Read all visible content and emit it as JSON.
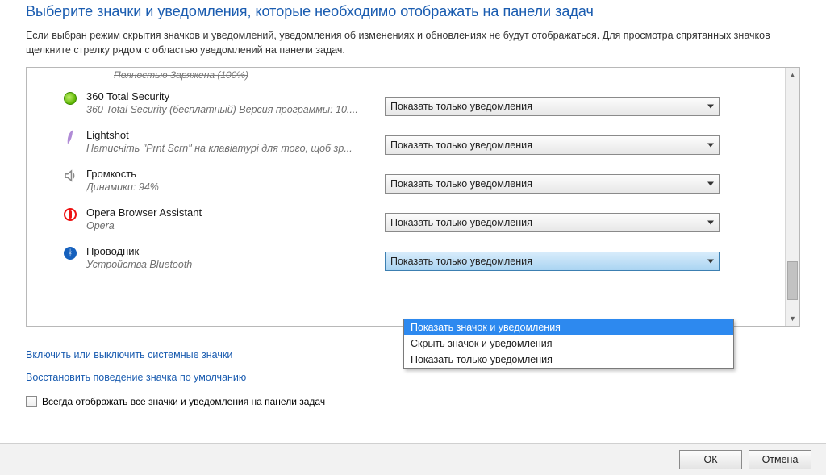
{
  "header": {
    "title": "Выберите значки и уведомления, которые необходимо отображать на панели задач",
    "subtitle": "Если выбран режим скрытия значков и уведомлений, уведомления об изменениях и обновлениях не будут отображаться. Для просмотра спрятанных значков щелкните стрелку рядом с областью уведомлений на панели задач."
  },
  "truncated_prev": "Полностью Заряжена (100%)",
  "items": [
    {
      "icon": "360-icon",
      "title": "360 Total Security",
      "desc": "360 Total Security (бесплатный) Версия программы: 10....",
      "select": "Показать только уведомления"
    },
    {
      "icon": "lightshot-icon",
      "title": "Lightshot",
      "desc": "Натисніть \"Prnt Scrn\" на клавіатурі для того, щоб зр...",
      "select": "Показать только уведомления"
    },
    {
      "icon": "speaker-icon",
      "title": "Громкость",
      "desc": "Динамики: 94%",
      "select": "Показать только уведомления"
    },
    {
      "icon": "opera-icon",
      "title": "Opera Browser Assistant",
      "desc": "Opera",
      "select": "Показать только уведомления"
    },
    {
      "icon": "bluetooth-icon",
      "title": "Проводник",
      "desc": "Устройства Bluetooth",
      "select": "Показать только уведомления"
    }
  ],
  "dropdown": {
    "options": [
      "Показать значок и уведомления",
      "Скрыть значок и уведомления",
      "Показать только уведомления"
    ],
    "highlighted": 0
  },
  "links": {
    "system_icons": "Включить или выключить системные значки",
    "restore_default": "Восстановить поведение значка по умолчанию"
  },
  "checkbox_label": "Всегда отображать все значки и уведомления на панели задач",
  "footer": {
    "ok": "ОК",
    "cancel": "Отмена"
  }
}
